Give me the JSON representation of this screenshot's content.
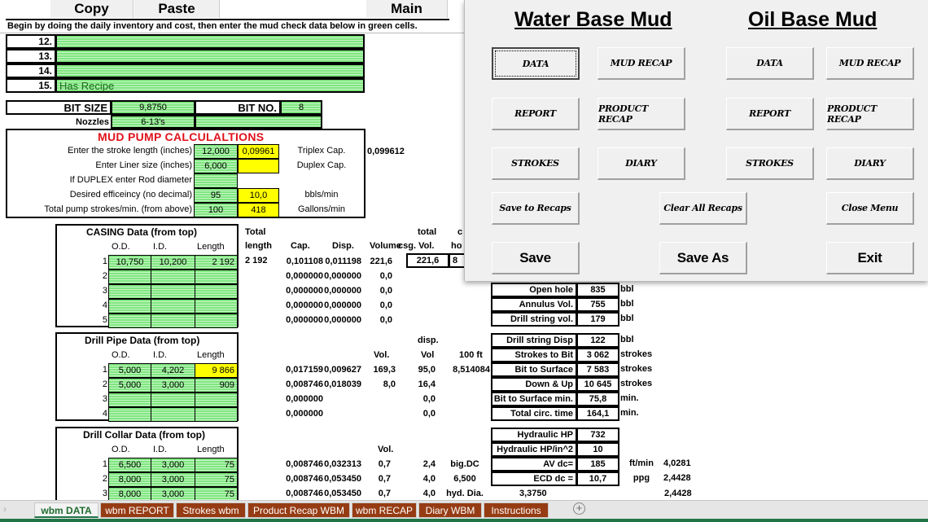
{
  "toolbar": {
    "copy": "Copy",
    "paste": "Paste",
    "main": "Main"
  },
  "instruction": "Begin by  doing the daily inventory and cost, then enter the mud check data below in green cells.",
  "numbered_rows": [
    {
      "num": "12.",
      "value": ""
    },
    {
      "num": "13.",
      "value": ""
    },
    {
      "num": "14.",
      "value": ""
    },
    {
      "num": "15.",
      "value": "Has Recipe"
    }
  ],
  "bit": {
    "size_label": "BIT  SIZE",
    "size": "9,8750",
    "no_label": "BIT  NO.",
    "no": "8",
    "nozzles_label": "Nozzles",
    "nozzles": "6-13's"
  },
  "pump": {
    "title": "MUD PUMP CALCULALTIONS",
    "rows": [
      {
        "label": "Enter the stroke length (inches)",
        "input": "12,000",
        "calc": "0,09961",
        "unit": "Triplex Cap."
      },
      {
        "label": "Enter Liner size (inches)",
        "input": "6,000",
        "calc": "",
        "unit": "Duplex Cap."
      },
      {
        "label": "If   DUPLEX  enter Rod diameter",
        "input": "",
        "calc": "",
        "unit": ""
      },
      {
        "label": "Desired efficeincy (no decimal)",
        "input": "95",
        "calc": "10,0",
        "unit": "bbls/min"
      },
      {
        "label": "Total pump strokes/min. (from above)",
        "input": "100",
        "calc": "418",
        "unit": "Gallons/min"
      }
    ],
    "triplex_value": "0,099612"
  },
  "casing": {
    "title": "CASING   Data (from top)",
    "headers": [
      "O.D.",
      "I.D.",
      "Length"
    ],
    "rows": [
      {
        "n": "1",
        "od": "10,750",
        "id": "10,200",
        "len": "2 192",
        "cap": "0,101108",
        "disp": "0,011198",
        "vol": "221,6"
      },
      {
        "n": "2",
        "od": "",
        "id": "",
        "len": "",
        "cap": "0,000000",
        "disp": "0,000000",
        "vol": "0,0"
      },
      {
        "n": "3",
        "od": "",
        "id": "",
        "len": "",
        "cap": "0,000000",
        "disp": "0,000000",
        "vol": "0,0"
      },
      {
        "n": "4",
        "od": "",
        "id": "",
        "len": "",
        "cap": "0,000000",
        "disp": "0,000000",
        "vol": "0,0"
      },
      {
        "n": "5",
        "od": "",
        "id": "",
        "len": "",
        "cap": "0,000000",
        "disp": "0,000000",
        "vol": "0,0"
      }
    ],
    "total_length_label1": "Total",
    "total_length_label2": "length",
    "total_length": "2 192",
    "col_cap": "Cap.",
    "col_disp": "Disp.",
    "col_volume": "Volume",
    "total_csg_label1": "total",
    "total_csg_label2": "csg. Vol.",
    "total_csg": "221,6",
    "hole_label1": "c",
    "hole_label2": "ho",
    "hole_value": "8"
  },
  "drillpipe": {
    "title": "Drill Pipe  Data (from top)",
    "headers": [
      "O.D.",
      "I.D.",
      "Length"
    ],
    "col_vol": "Vol.",
    "col_disp1": "disp.",
    "col_disp2": "Vol",
    "col_100ft": "100 ft",
    "rows": [
      {
        "n": "1",
        "od": "5,000",
        "id": "4,202",
        "len": "9 866",
        "cap": "0,017159",
        "disp": "0,009627",
        "vol": "169,3",
        "dvol": "95,0",
        "extra": "8,514084"
      },
      {
        "n": "2",
        "od": "5,000",
        "id": "3,000",
        "len": "909",
        "cap": "0,008746",
        "disp": "0,018039",
        "vol": "8,0",
        "dvol": "16,4",
        "extra": ""
      },
      {
        "n": "3",
        "od": "",
        "id": "",
        "len": "",
        "cap": "0,000000",
        "disp": "",
        "vol": "",
        "dvol": "0,0",
        "extra": ""
      },
      {
        "n": "4",
        "od": "",
        "id": "",
        "len": "",
        "cap": "0,000000",
        "disp": "",
        "vol": "",
        "dvol": "0,0",
        "extra": ""
      }
    ]
  },
  "collar": {
    "title": "Drill Collar Data (from top)",
    "headers": [
      "O.D.",
      "I.D.",
      "Length"
    ],
    "col_vol": "Vol.",
    "rows": [
      {
        "n": "1",
        "od": "6,500",
        "id": "3,000",
        "len": "75",
        "cap": "0,008746",
        "disp": "0,032313",
        "vol": "0,7",
        "dvol": "2,4",
        "extra": "big.DC"
      },
      {
        "n": "2",
        "od": "8,000",
        "id": "3,000",
        "len": "75",
        "cap": "0,008746",
        "disp": "0,053450",
        "vol": "0,7",
        "dvol": "4,0",
        "extra": "6,500"
      },
      {
        "n": "3",
        "od": "8,000",
        "id": "3,000",
        "len": "75",
        "cap": "0,008746",
        "disp": "0,053450",
        "vol": "0,7",
        "dvol": "4,0",
        "extra": "hyd. Dia."
      }
    ],
    "hyd_dia": "3,3750"
  },
  "summary1": [
    {
      "label": "Open hole",
      "value": "835",
      "unit": "bbl"
    },
    {
      "label": "Annulus Vol.",
      "value": "755",
      "unit": "bbl"
    },
    {
      "label": "Drill string vol.",
      "value": "179",
      "unit": "bbl"
    }
  ],
  "summary2": [
    {
      "label": "Drill string Disp",
      "value": "122",
      "unit": "bbl"
    },
    {
      "label": "Strokes to Bit",
      "value": "3 062",
      "unit": "strokes"
    },
    {
      "label": "Bit to Surface",
      "value": "7 583",
      "unit": "strokes"
    },
    {
      "label": "Down & Up",
      "value": "10 645",
      "unit": "strokes"
    },
    {
      "label": "Bit to Surface min.",
      "value": "75,8",
      "unit": "min."
    },
    {
      "label": "Total circ. time",
      "value": "164,1",
      "unit": "min."
    }
  ],
  "hydraulics": [
    {
      "label": "Hydraulic HP",
      "value": "732",
      "unit": "",
      "extra": ""
    },
    {
      "label": "Hydraulic HP/in^2",
      "value": "10",
      "unit": "",
      "extra": ""
    },
    {
      "label": "AV  dc=",
      "value": "185",
      "unit": "ft/min",
      "extra": "4,0281"
    },
    {
      "label": "ECD  dc =",
      "value": "10,7",
      "unit": "ppg",
      "extra": "2,4428"
    }
  ],
  "hyd_extra_last": "2,4428",
  "menu": {
    "wbm_title": "Water Base Mud",
    "obm_title": "Oil Base Mud",
    "wbm_buttons": [
      "DATA",
      "MUD RECAP",
      "REPORT",
      "PRODUCT RECAP",
      "STROKES",
      "DIARY"
    ],
    "obm_buttons": [
      "DATA",
      "MUD RECAP",
      "REPORT",
      "PRODUCT RECAP",
      "STROKES",
      "DIARY"
    ],
    "save_to_recaps": "Save to Recaps",
    "clear_all_recaps": "Clear All Recaps",
    "close_menu": "Close Menu",
    "save": "Save",
    "save_as": "Save As",
    "exit": "Exit"
  },
  "tabs": [
    "wbm DATA",
    "wbm REPORT",
    "Strokes wbm",
    "Product Recap WBM",
    "wbm RECAP",
    "Diary WBM",
    "Instructions"
  ],
  "active_tab": "wbm DATA",
  "colors": {
    "input_green": "#7fe67f",
    "calc_yellow": "#ffff00",
    "tab_brown": "#963c14",
    "title_red": "#e0121b",
    "excel_green": "#217346"
  }
}
